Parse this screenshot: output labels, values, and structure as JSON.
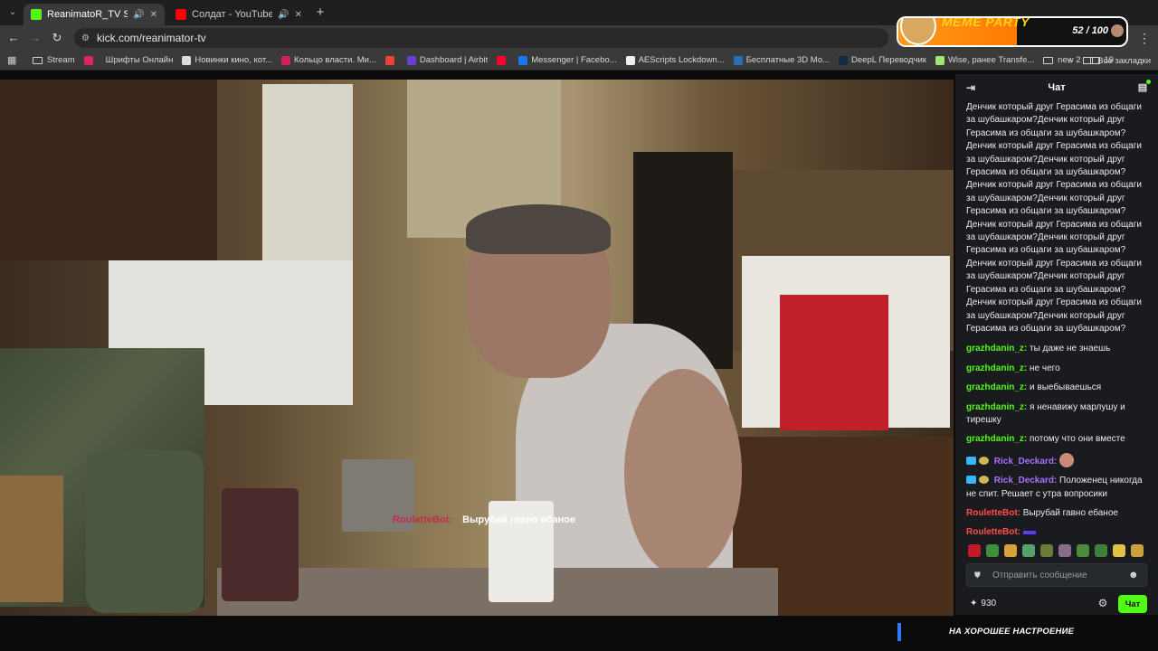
{
  "browser": {
    "tabs": [
      {
        "title": "ReanimatoR_TV Stream - W",
        "favicon_color": "#53fc18",
        "active": true
      },
      {
        "title": "Солдат - YouTube",
        "favicon_color": "#ff0000",
        "active": false
      }
    ],
    "url": "kick.com/reanimator-tv",
    "bookmarks": [
      {
        "label": "Stream",
        "type": "folder"
      },
      {
        "label": "",
        "type": "icon",
        "color": "#e0245e"
      },
      {
        "label": "Шрифты Онлайн",
        "type": "text"
      },
      {
        "label": "Новинки кино, кот...",
        "type": "icon",
        "color": "#dddddd"
      },
      {
        "label": "Кольцо власти. Ми...",
        "type": "icon",
        "color": "#d21f5a"
      },
      {
        "label": "",
        "type": "icon",
        "color": "#ea4335"
      },
      {
        "label": "Dashboard | Airbit",
        "type": "icon",
        "color": "#6b3fd6"
      },
      {
        "label": "",
        "type": "icon",
        "color": "#ff0033"
      },
      {
        "label": "Messenger | Facebo...",
        "type": "icon",
        "color": "#1877f2"
      },
      {
        "label": "AEScripts Lockdown...",
        "type": "icon",
        "color": "#eeeeee"
      },
      {
        "label": "Бесплатные 3D Мо...",
        "type": "icon",
        "color": "#2a6fb6"
      },
      {
        "label": "DeepL Переводчик",
        "type": "icon",
        "color": "#0f2b46"
      },
      {
        "label": "Wise, ранее Transfe...",
        "type": "icon",
        "color": "#9fe870"
      },
      {
        "label": "new 2",
        "type": "folder"
      },
      {
        "label": "19",
        "type": "folder"
      }
    ],
    "all_bookmarks": "Все закладки"
  },
  "overlay": {
    "chat_user": "RouletteBot:",
    "chat_message": "Вырубай гавно ебаное",
    "ticker": "НА ХОРОШЕЕ НАСТРОЕНИЕ"
  },
  "meme_party": {
    "title": "MEME PARTY",
    "count": "52 / 100",
    "progress": 0.52
  },
  "chat": {
    "title": "Чат",
    "spam": "Денчик который друг Герасима из общаги за шубашкаром?Денчик который друг Герасима из общаги за шубашкаром?Денчик который друг Герасима из общаги за шубашкаром?Денчик который друг Герасима из общаги за шубашкаром?Денчик который друг Герасима из общаги за шубашкаром?Денчик который друг Герасима из общаги за шубашкаром?Денчик который друг Герасима из общаги за шубашкаром?Денчик который друг Герасима из общаги за шубашкаром?Денчик который друг Герасима из общаги за шубашкаром?Денчик который друг Герасима из общаги за шубашкаром?Денчик который друг Герасима из общаги за шубашкаром?Денчик который друг Герасима из общаги за шубашкаром?",
    "messages": [
      {
        "user": "grazhdanin_z:",
        "text": "ты даже не знаешь"
      },
      {
        "user": "grazhdanin_z:",
        "text": "не чего"
      },
      {
        "user": "grazhdanin_z:",
        "text": "и выебываешься"
      },
      {
        "user": "grazhdanin_z:",
        "text": "я ненавижу марлушу и тирешку"
      },
      {
        "user": "grazhdanin_z:",
        "text": "потому что они вместе"
      },
      {
        "user": "Rick_Deckard:",
        "text": ""
      },
      {
        "user": "Rick_Deckard:",
        "text": "Положенец никогда не спит. Решает с утра вопросики"
      },
      {
        "user": "RouletteBot:",
        "text": "Вырубай гавно ебаное"
      },
      {
        "user": "RouletteBot:",
        "text": ""
      }
    ],
    "input_placeholder": "Отправить сообщение",
    "points": "930",
    "send_button": "Чат",
    "colors": {
      "green": "#53fc18",
      "purple": "#a970ff",
      "red": "#ff4d4d"
    }
  }
}
